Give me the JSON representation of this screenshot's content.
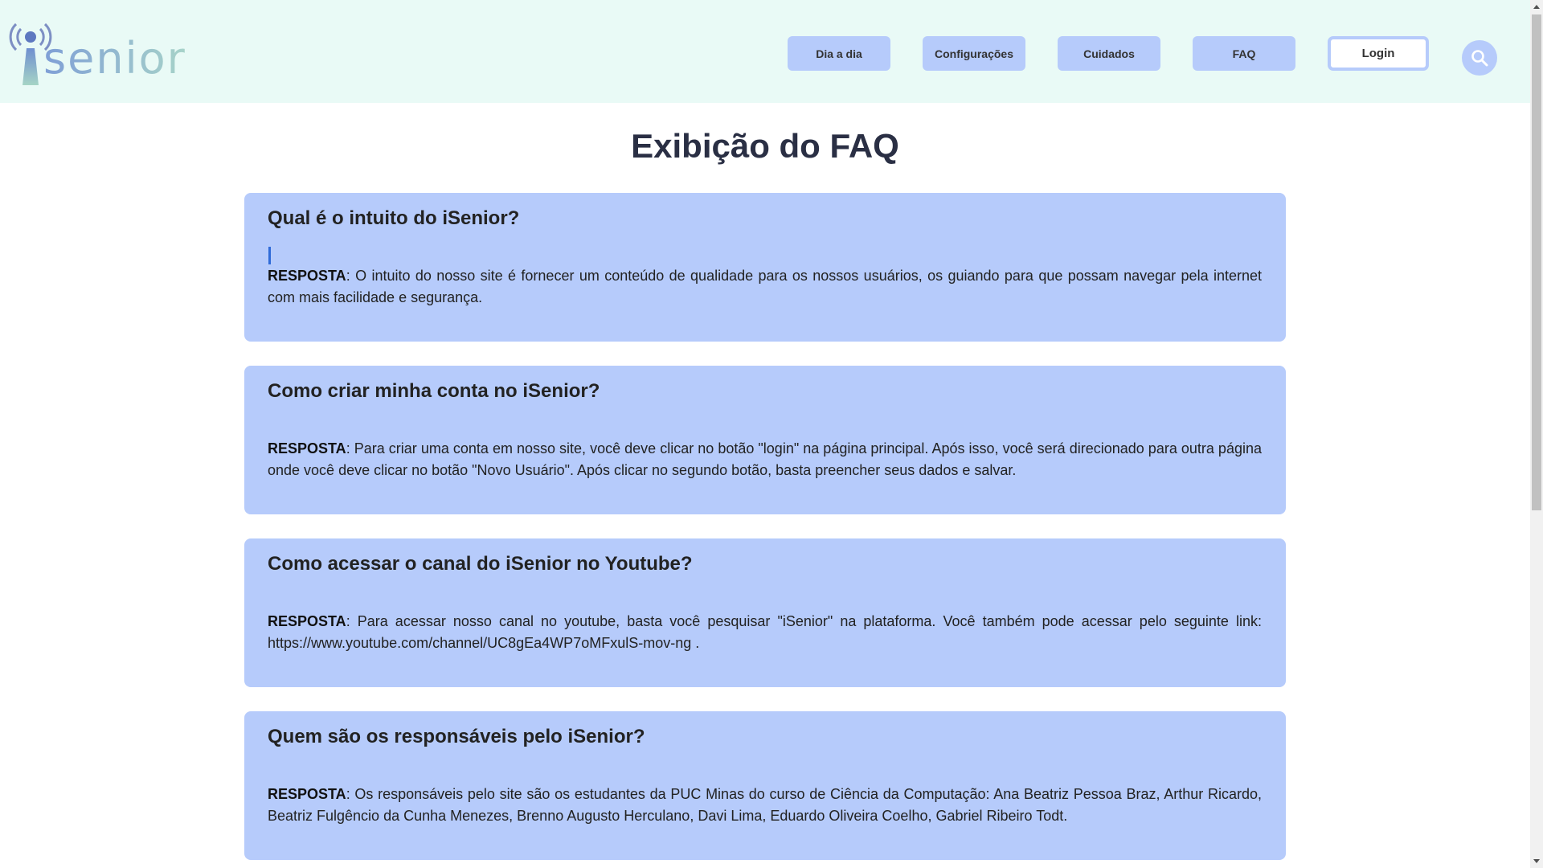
{
  "header": {
    "logo_text": "senior",
    "nav": [
      {
        "label": "Dia a dia"
      },
      {
        "label": "Configurações"
      },
      {
        "label": "Cuidados"
      },
      {
        "label": "FAQ"
      }
    ],
    "login_label": "Login",
    "search_icon": "search-icon"
  },
  "main": {
    "title": "Exibição do FAQ",
    "answer_prefix": "RESPOSTA",
    "faqs": [
      {
        "question": "Qual é o intuito do iSenior?",
        "answer": ": O intuito do nosso site é fornecer um conteúdo de qualidade para os nossos usuários, os guiando para que possam navegar pela internet com mais facilidade e segurança."
      },
      {
        "question": "Como criar minha conta no iSenior?",
        "answer": ": Para criar uma conta em nosso site, você deve clicar no botão \"login\" na página principal. Após isso, você será direcionado para outra página onde você deve clicar no botão \"Novo Usuário\". Após clicar no segundo botão, basta preencher seus dados e salvar."
      },
      {
        "question": "Como acessar o canal do iSenior no Youtube?",
        "answer": ": Para acessar nosso canal no youtube, basta você pesquisar \"iSenior\" na plataforma. Você também pode acessar pelo seguinte link: https://www.youtube.com/channel/UC8gEa4WP7oMFxulS-mov-ng ."
      },
      {
        "question": "Quem são os responsáveis pelo iSenior?",
        "answer": ": Os responsáveis pelo site são os estudantes da PUC Minas do curso de Ciência da Computação: Ana Beatriz Pessoa Braz, Arthur Ricardo, Beatriz Fulgêncio da Cunha Menezes, Brenno Augusto Herculano, Davi Lima, Eduardo Oliveira Coelho, Gabriel Ribeiro Todt."
      }
    ]
  },
  "colors": {
    "header_bg": "#e9faf6",
    "card_bg": "#b6cbfb",
    "title_text": "#2a2f44"
  }
}
